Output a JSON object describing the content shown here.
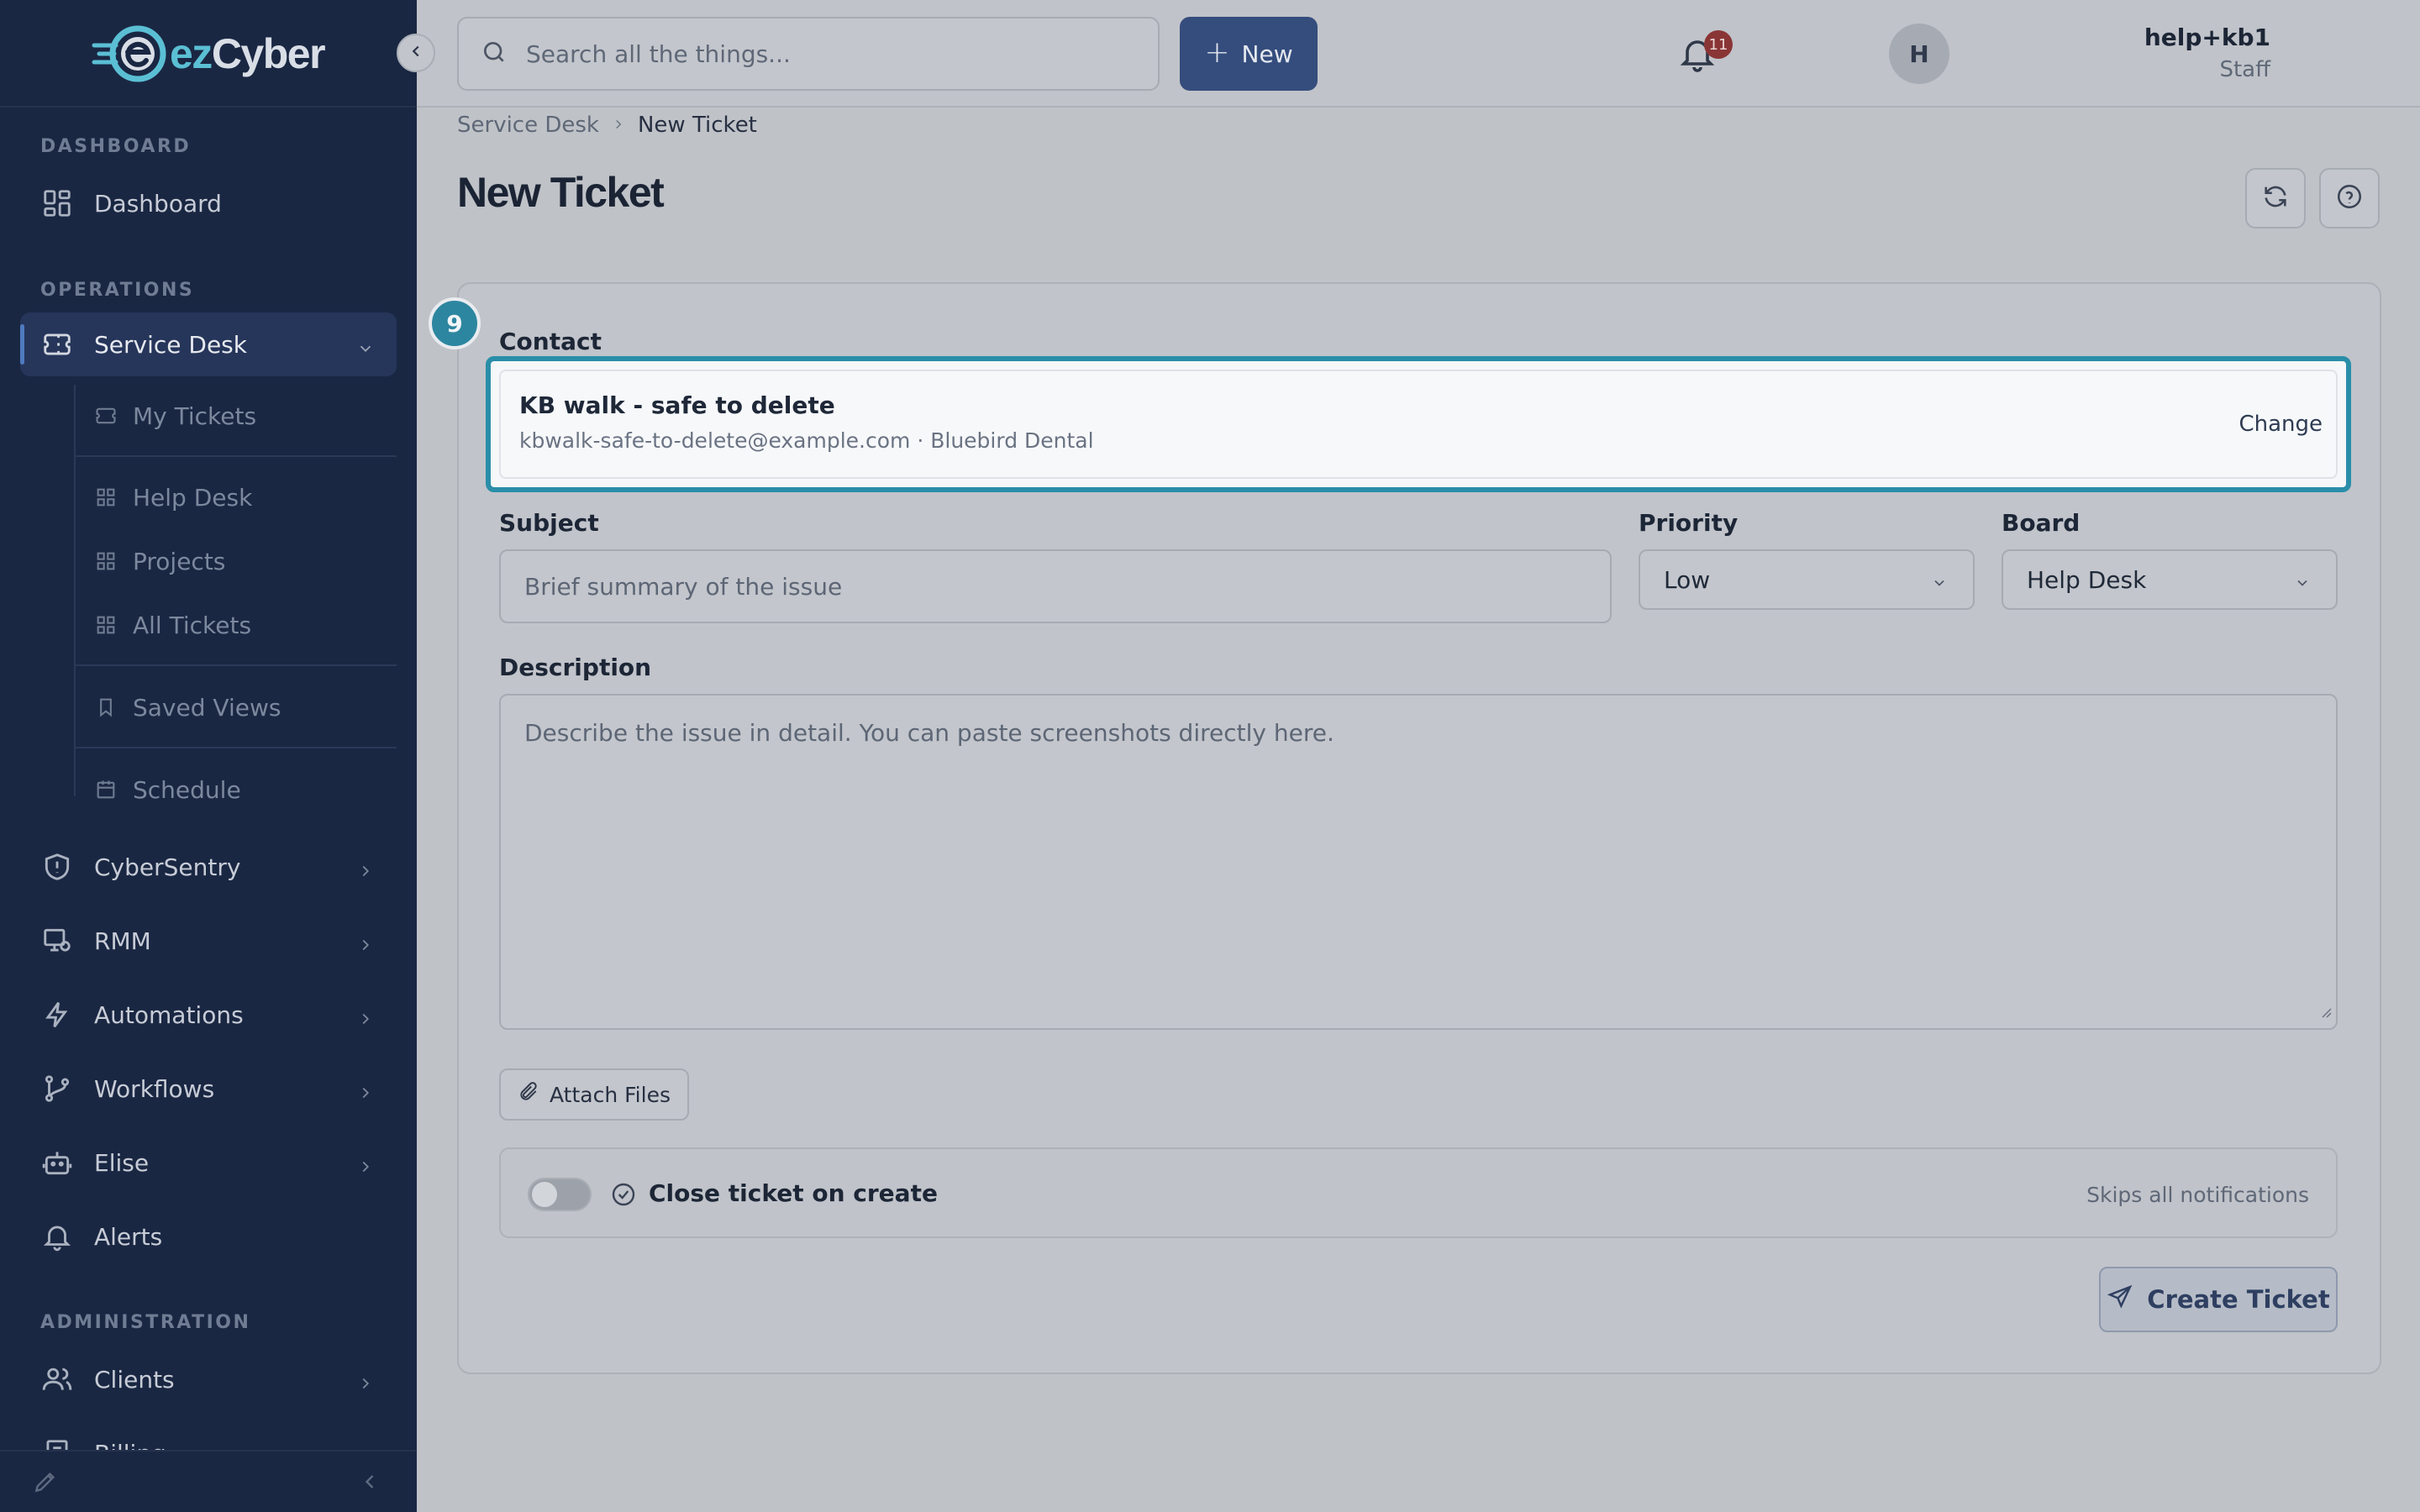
{
  "brand": {
    "logo_prefix": "ez",
    "logo_suffix": "Cyber",
    "accent": "#5bbfd4"
  },
  "sidebar": {
    "sections": {
      "dashboard": "DASHBOARD",
      "operations": "OPERATIONS",
      "administration": "ADMINISTRATION"
    },
    "items": {
      "dashboard": "Dashboard",
      "service_desk": "Service Desk",
      "cybersentry": "CyberSentry",
      "rmm": "RMM",
      "automations": "Automations",
      "workflows": "Workflows",
      "elise": "Elise",
      "alerts": "Alerts",
      "clients": "Clients",
      "billing": "Billing"
    },
    "sub_items": {
      "my_tickets": "My Tickets",
      "help_desk": "Help Desk",
      "projects": "Projects",
      "all_tickets": "All Tickets",
      "saved_views": "Saved Views",
      "schedule": "Schedule"
    }
  },
  "topbar": {
    "search_placeholder": "Search all the things...",
    "new_label": "New",
    "notification_count": "11",
    "user_name": "help+kb1",
    "user_role": "Staff",
    "avatar_initial": "H"
  },
  "breadcrumb": {
    "parent": "Service Desk",
    "current": "New Ticket"
  },
  "page": {
    "title": "New Ticket"
  },
  "form": {
    "step_number": "9",
    "contact_label": "Contact",
    "contact": {
      "name": "KB walk - safe to delete",
      "email": "kbwalk-safe-to-delete@example.com",
      "company": "Bluebird Dental",
      "meta": "kbwalk-safe-to-delete@example.com · Bluebird Dental",
      "change_label": "Change"
    },
    "subject_label": "Subject",
    "subject_placeholder": "Brief summary of the issue",
    "subject_value": "",
    "priority_label": "Priority",
    "priority_value": "Low",
    "board_label": "Board",
    "board_value": "Help Desk",
    "description_label": "Description",
    "description_placeholder": "Describe the issue in detail. You can paste screenshots directly here.",
    "description_value": "",
    "attach_label": "Attach Files",
    "close_on_create_label": "Close ticket on create",
    "close_on_create_enabled": false,
    "close_on_create_note": "Skips all notifications",
    "create_label": "Create Ticket"
  }
}
